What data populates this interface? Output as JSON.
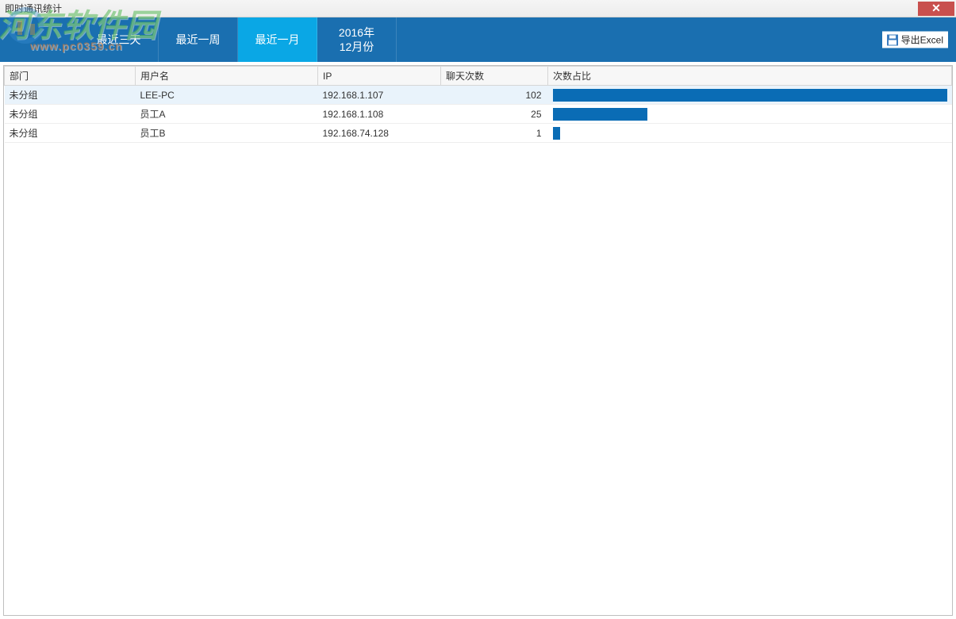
{
  "window": {
    "title": "即时通讯统计",
    "close_label": "✕"
  },
  "watermark": {
    "text": "河东软件园",
    "sub": "www.pc0359.cn"
  },
  "toolbar": {
    "tabs": [
      {
        "label": "最近三天",
        "active": false
      },
      {
        "label": "最近一周",
        "active": false
      },
      {
        "label": "最近一月",
        "active": true
      },
      {
        "label": "2016年\n12月份",
        "active": false
      }
    ],
    "export_label": "导出Excel"
  },
  "table": {
    "headers": {
      "dept": "部门",
      "user": "用户名",
      "ip": "IP",
      "count": "聊天次数",
      "ratio": "次数占比"
    },
    "rows": [
      {
        "dept": "未分组",
        "user": "LEE-PC",
        "ip": "192.168.1.107",
        "count": "102",
        "bar_pct": 100,
        "selected": true
      },
      {
        "dept": "未分组",
        "user": "员工A",
        "ip": "192.168.1.108",
        "count": "25",
        "bar_pct": 24,
        "selected": false
      },
      {
        "dept": "未分组",
        "user": "员工B",
        "ip": "192.168.74.128",
        "count": "1",
        "bar_pct": 2,
        "selected": false
      }
    ]
  },
  "chart_data": {
    "type": "bar",
    "title": "即时通讯统计 — 次数占比",
    "xlabel": "用户名",
    "ylabel": "聊天次数",
    "categories": [
      "LEE-PC",
      "员工A",
      "员工B"
    ],
    "values": [
      102,
      25,
      1
    ],
    "ylim": [
      0,
      102
    ]
  },
  "colors": {
    "toolbar_bg": "#1a6fb0",
    "tab_active": "#0aa7e5",
    "bar_fill": "#0a6cb5",
    "row_selected": "#e9f3fb",
    "close_btn": "#c8504e"
  }
}
